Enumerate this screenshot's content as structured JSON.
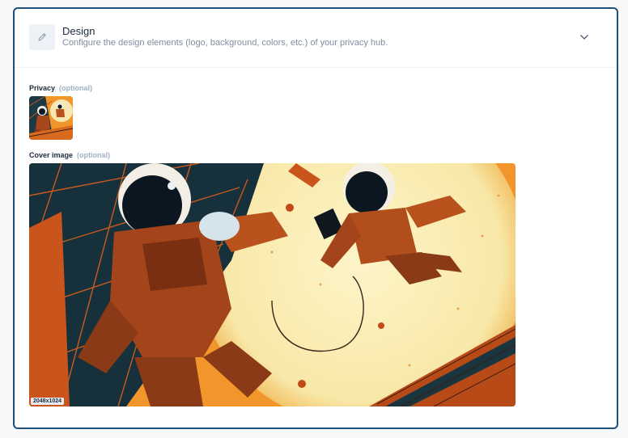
{
  "section": {
    "title": "Design",
    "subtitle": "Configure the design elements (logo, background, colors, etc.) of your privacy hub.",
    "icon": "pencil-icon",
    "expand_icon": "chevron-down-icon"
  },
  "fields": {
    "privacy": {
      "label": "Privacy",
      "optional": "(optional)"
    },
    "cover": {
      "label": "Cover image",
      "optional": "(optional)",
      "dimensions": "2048x1024"
    }
  },
  "colors": {
    "border": "#1f4f7b",
    "title": "#1e2b3c",
    "muted": "#7f8ea0",
    "optional": "#9fb1c4"
  }
}
